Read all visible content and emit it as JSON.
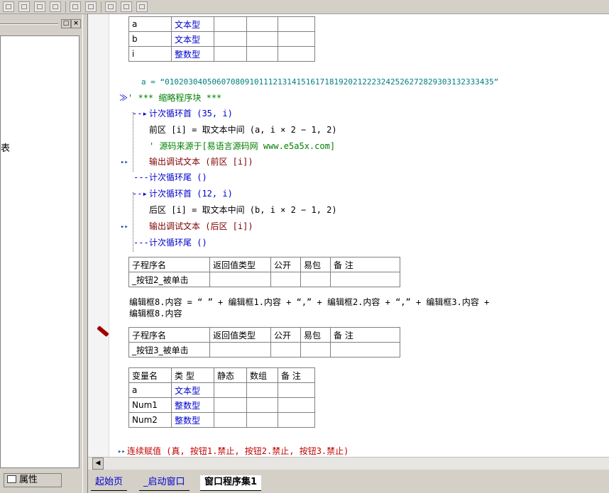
{
  "left_panel": {
    "title_buttons": [
      "□",
      "×"
    ],
    "side_glyph": "表",
    "properties_tab": "属性"
  },
  "var_table_top": [
    [
      "a",
      "文本型"
    ],
    [
      "b",
      "文本型"
    ],
    [
      "i",
      "整数型"
    ]
  ],
  "code": {
    "assign_a": "a = “0102030405060708091011121314151617181920212223242526272829303132333435”",
    "fold_comment": "' *** 缩略程序块 ***",
    "loop1_head": "计次循环首 (35, i)",
    "loop1_body1": "前区 [i] = 取文本中间 (a, i × 2 − 1, 2)",
    "loop1_comment": "' 源码来源于[易语言源码网 www.e5a5x.com]",
    "loop1_debug": "输出调试文本 (前区 [i])",
    "loop1_tail": "计次循环尾 ()",
    "loop2_head": "计次循环首 (12, i)",
    "loop2_body1": "后区 [i] = 取文本中间 (b, i × 2 − 1, 2)",
    "loop2_debug": "输出调试文本 (后区 [i])",
    "loop2_tail": "计次循环尾 ()",
    "edit_assign_1": "编辑框8.内容 = “  ” + 编辑框1.内容 + “,” + 编辑框2.内容 + “,” + 编辑框3.内容 +",
    "edit_assign_2": "编辑框8.内容",
    "continuous_assign": "连续赋值 (真, 按钮1.禁止, 按钮2.禁止, 按钮3.禁止)"
  },
  "sub_header": {
    "columns": [
      "子程序名",
      "返回值类型",
      "公开",
      "易包",
      "备 注"
    ]
  },
  "sub1_name": "_按钮2_被单击",
  "sub2_name": "_按钮3_被单击",
  "var_table_bottom": {
    "columns": [
      "变量名",
      "类 型",
      "静态",
      "数组",
      "备 注"
    ],
    "rows": [
      [
        "a",
        "文本型"
      ],
      [
        "Num1",
        "整数型"
      ],
      [
        "Num2",
        "整数型"
      ]
    ]
  },
  "tabs": [
    "起始页",
    "_启动窗口",
    "窗口程序集1"
  ]
}
